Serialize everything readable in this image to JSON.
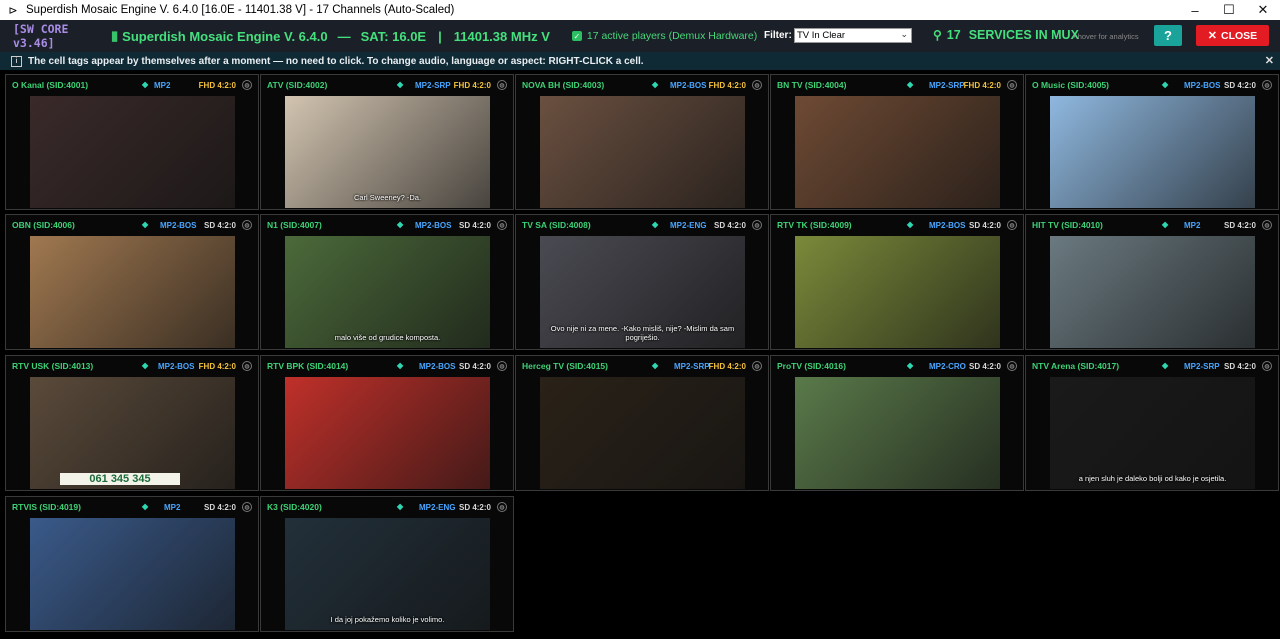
{
  "window": {
    "icon": "satellite-icon",
    "title": "Superdish Mosaic Engine V. 6.4.0 [16.0E - 11401.38 V] - 17 Channels (Auto-Scaled)",
    "minimize": "–",
    "maximize": "☐",
    "close": "✕"
  },
  "header": {
    "core_tag": "[SW CORE v3.46]",
    "engine_label": "Superdish Mosaic Engine V. 6.4.0",
    "sep1": "—",
    "sat_label": "SAT: 16.0E",
    "sep2": "|",
    "freq_label": "11401.38 MHz V",
    "active_players": "17 active players (Demux Hardware)",
    "filter_label": "Filter:",
    "filter_value": "TV In Clear",
    "services_count": "17",
    "services_label": "SERVICES IN MUX",
    "hover_hint": "• hover for analytics",
    "help_label": "?",
    "close_label": "CLOSE"
  },
  "infobar": {
    "text": "The cell tags appear by themselves after a moment — no need to click.   To change audio, language or aspect: RIGHT-CLICK a cell.",
    "dismiss": "✕"
  },
  "colors": {
    "fhd": "#f2c13b",
    "sd": "#d8d8d8",
    "accent_green": "#45e07e",
    "audio_blue": "#49a6ff"
  },
  "channels": [
    {
      "name": "O Kanal (SID:4001)",
      "audio": "MP2",
      "format": "FHD 4:2:0",
      "hd": true,
      "subtitle": "",
      "scene": "#3a2a2a"
    },
    {
      "name": "ATV (SID:4002)",
      "audio": "MP2-SRP",
      "format": "FHD 4:2:0",
      "hd": true,
      "subtitle": "Carl Sweeney? -Da.",
      "scene": "#d2c4b0"
    },
    {
      "name": "NOVA BH (SID:4003)",
      "audio": "MP2-BOS",
      "format": "FHD 4:2:0",
      "hd": true,
      "subtitle": "",
      "scene": "#6a5040"
    },
    {
      "name": "BN TV (SID:4004)",
      "audio": "MP2-SRP",
      "format": "FHD 4:2:0",
      "hd": true,
      "subtitle": "",
      "scene": "#6e4a34"
    },
    {
      "name": "O Music (SID:4005)",
      "audio": "MP2-BOS",
      "format": "SD 4:2:0",
      "hd": false,
      "subtitle": "",
      "scene": "#8fb8df"
    },
    {
      "name": "OBN (SID:4006)",
      "audio": "MP2-BOS",
      "format": "SD 4:2:0",
      "hd": false,
      "subtitle": "",
      "scene": "#a07850"
    },
    {
      "name": "N1 (SID:4007)",
      "audio": "MP2-BOS",
      "format": "SD 4:2:0",
      "hd": false,
      "subtitle": "malo više od grudice komposta.",
      "scene": "#4b6a3a"
    },
    {
      "name": "TV SA (SID:4008)",
      "audio": "MP2-ENG",
      "format": "SD 4:2:0",
      "hd": false,
      "subtitle": "Ovo nije ni za mene. -Kako misliš, nije? -Mislim da sam pogriješio.",
      "scene": "#4a4a52"
    },
    {
      "name": "RTV TK (SID:4009)",
      "audio": "MP2-BOS",
      "format": "SD 4:2:0",
      "hd": false,
      "subtitle": "",
      "scene": "#7a8a3a"
    },
    {
      "name": "HIT TV (SID:4010)",
      "audio": "MP2",
      "format": "SD 4:2:0",
      "hd": false,
      "subtitle": "",
      "scene": "#6a7a80"
    },
    {
      "name": "RTV USK (SID:4013)",
      "audio": "MP2-BOS",
      "format": "FHD 4:2:0",
      "hd": true,
      "subtitle": "",
      "scene": "#5a4a3a",
      "caption": "061 345 345"
    },
    {
      "name": "RTV BPK (SID:4014)",
      "audio": "MP2-BOS",
      "format": "SD 4:2:0",
      "hd": false,
      "subtitle": "",
      "scene": "#c0302a"
    },
    {
      "name": "Herceg TV (SID:4015)",
      "audio": "MP2-SRP",
      "format": "FHD 4:2:0",
      "hd": true,
      "subtitle": "",
      "scene": "#2a2218"
    },
    {
      "name": "ProTV (SID:4016)",
      "audio": "MP2-CRO",
      "format": "SD 4:2:0",
      "hd": false,
      "subtitle": "",
      "scene": "#5a7a4a"
    },
    {
      "name": "NTV Arena (SID:4017)",
      "audio": "MP2-SRP",
      "format": "SD 4:2:0",
      "hd": false,
      "subtitle": "a njen sluh je daleko bolji od kako je osjetila.",
      "scene": "#1a1a1a"
    },
    {
      "name": "RTVIS (SID:4019)",
      "audio": "MP2",
      "format": "SD 4:2:0",
      "hd": false,
      "subtitle": "",
      "scene": "#3a5a8a"
    },
    {
      "name": "K3 (SID:4020)",
      "audio": "MP2-ENG",
      "format": "SD 4:2:0",
      "hd": false,
      "subtitle": "I da joj pokažemo koliko je volimo.",
      "scene": "#22303a"
    }
  ]
}
